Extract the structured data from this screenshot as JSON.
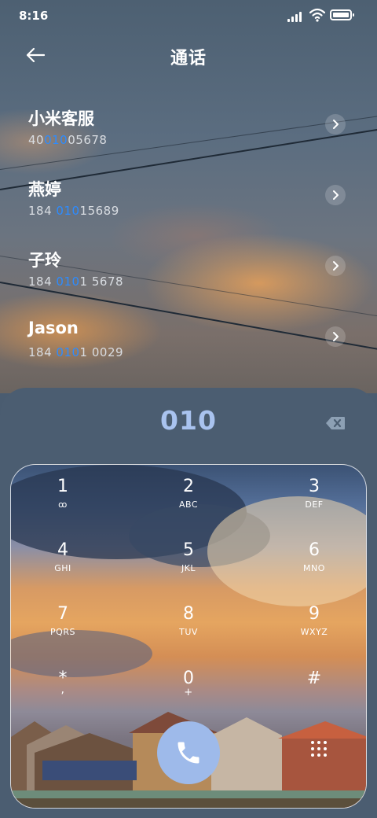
{
  "status_bar": {
    "time": "8:16"
  },
  "header": {
    "title": "通话"
  },
  "contacts": [
    {
      "name": "小米客服",
      "number_pre": "40",
      "number_hl": "010",
      "number_post": "05678"
    },
    {
      "name": "燕婷",
      "number_pre": "184 ",
      "number_hl": "010",
      "number_post": "15689"
    },
    {
      "name": "子玲",
      "number_pre": "184 ",
      "number_hl": "010",
      "number_post": "1 5678"
    },
    {
      "name": "Jason",
      "number_pre": "184 ",
      "number_hl": "010",
      "number_post": "1 0029"
    }
  ],
  "dialer": {
    "dialed_number": "010",
    "keys": [
      {
        "digit": "1",
        "letters": "ꝏ"
      },
      {
        "digit": "2",
        "letters": "ABC"
      },
      {
        "digit": "3",
        "letters": "DEF"
      },
      {
        "digit": "4",
        "letters": "GHI"
      },
      {
        "digit": "5",
        "letters": "JKL"
      },
      {
        "digit": "6",
        "letters": "MNO"
      },
      {
        "digit": "7",
        "letters": "PQRS"
      },
      {
        "digit": "8",
        "letters": "TUV"
      },
      {
        "digit": "9",
        "letters": "WXYZ"
      },
      {
        "digit": "*",
        "letters": ","
      },
      {
        "digit": "0",
        "letters": "+"
      },
      {
        "digit": "#",
        "letters": ""
      }
    ]
  },
  "colors": {
    "highlight": "#2d8cff",
    "dialed": "#a9c3ef",
    "call_button": "#9ebaea"
  },
  "icons": [
    "back-arrow-icon",
    "chevron-right-icon",
    "backspace-icon",
    "phone-icon",
    "grid-dots-icon",
    "signal-icon",
    "wifi-icon",
    "battery-icon",
    "voicemail-icon"
  ]
}
